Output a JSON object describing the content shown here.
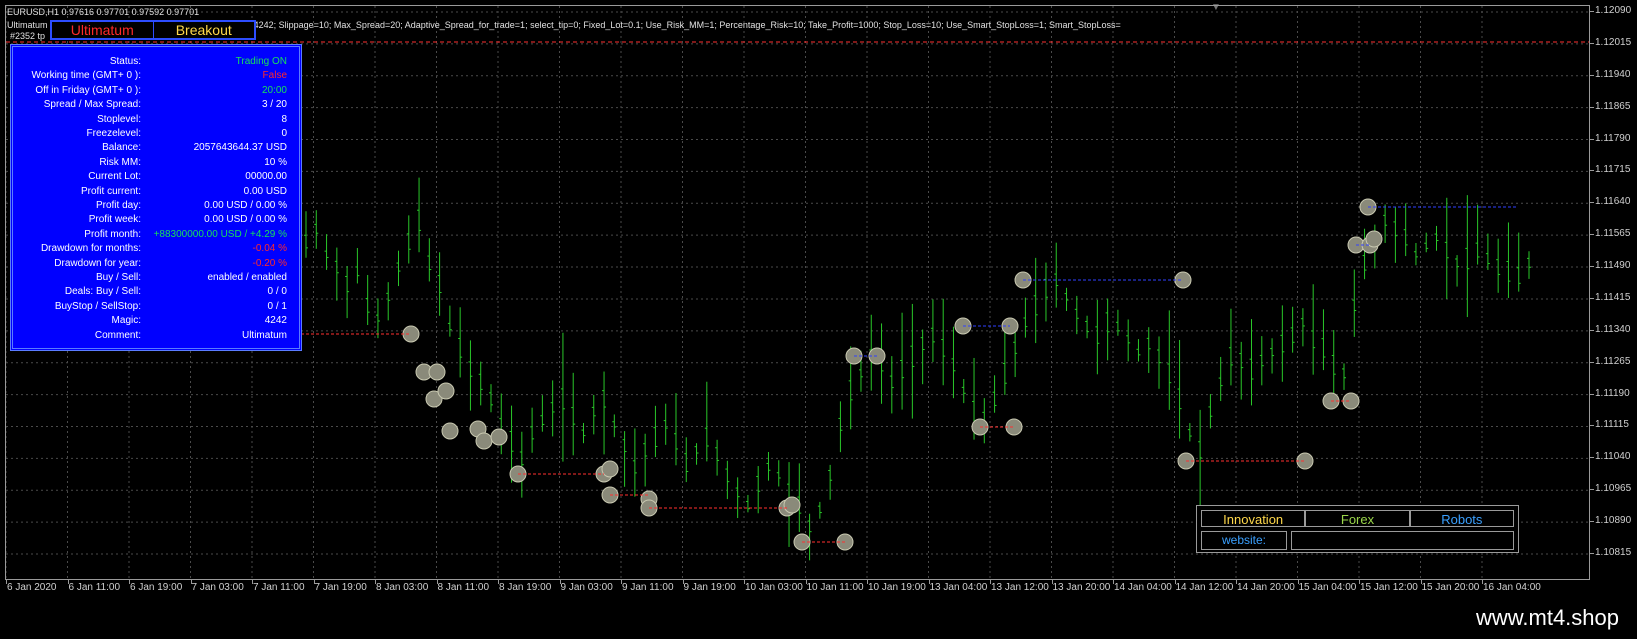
{
  "header": {
    "symbol_line": "EURUSD,H1  0.97616 0.97701 0.97592 0.97701",
    "ea_line": "Ultimatum Breakout_fix testing with Fast_BackTest=1; Magic=4242; Slippage=10; Max_Spread=20; Adaptive_Spread_for_trade=1; select_tip=0; Fixed_Lot=0.1; Use_Risk_MM=1; Percentage_Risk=10; Take_Profit=1000; Stop_Loss=10; Use_Smart_StopLoss=1; Smart_StopLoss=",
    "tp_label": "#2352 tp"
  },
  "brand_tabs": [
    {
      "label": "Ultimatum",
      "color": "#ff2a2a"
    },
    {
      "label": "Breakout",
      "color": "#ffd84a"
    }
  ],
  "status_panel": {
    "rows": [
      {
        "label": "Status:",
        "value": "Trading ON",
        "color": "#18e05a"
      },
      {
        "label": "Working time (GMT+ 0 ):",
        "value": "False",
        "color": "#ff2a2a"
      },
      {
        "label": "Off in Friday (GMT+ 0 ):",
        "value": "20:00",
        "color": "#18e05a"
      },
      {
        "label": "Spread / Max Spread:",
        "value": "3 / 20",
        "color": "#ffffff"
      },
      {
        "label": "Stoplevel:",
        "value": "8",
        "color": "#ffffff"
      },
      {
        "label": "Freezelevel:",
        "value": "0",
        "color": "#ffffff"
      },
      {
        "label": "Balance:",
        "value": "2057643644.37 USD",
        "color": "#ffffff"
      },
      {
        "label": "Risk MM:",
        "value": "10 %",
        "color": "#ffffff"
      },
      {
        "label": "Current Lot:",
        "value": "00000.00",
        "color": "#ffffff"
      },
      {
        "label": "Profit current:",
        "value": "0.00 USD",
        "color": "#ffffff"
      },
      {
        "label": "Profit day:",
        "value": "0.00 USD / 0.00 %",
        "color": "#ffffff"
      },
      {
        "label": "Profit week:",
        "value": "0.00 USD / 0.00 %",
        "color": "#ffffff"
      },
      {
        "label": "Profit month:",
        "value": "+88300000.00 USD / +4.29 %",
        "color": "#18e05a"
      },
      {
        "label": "Drawdown for months:",
        "value": "-0.04 %",
        "color": "#ff2a2a"
      },
      {
        "label": "Drawdown for year:",
        "value": "-0.20 %",
        "color": "#ff2a2a"
      },
      {
        "label": "Buy / Sell:",
        "value": "enabled  /  enabled",
        "color": "#ffffff"
      },
      {
        "label": "Deals: Buy / Sell:",
        "value": "0  /  0",
        "color": "#ffffff"
      },
      {
        "label": "BuyStop / SellStop:",
        "value": "0  /  1",
        "color": "#ffffff"
      },
      {
        "label": "Magic:",
        "value": "4242",
        "color": "#ffffff"
      },
      {
        "label": "Comment:",
        "value": "Ultimatum",
        "color": "#ffffff"
      }
    ]
  },
  "links_panel": {
    "items": [
      {
        "label": "Innovation",
        "color": "#ffd84a"
      },
      {
        "label": "Forex",
        "color": "#9ad64a"
      },
      {
        "label": "Robots",
        "color": "#3aa0ff"
      }
    ],
    "website_label": "website:"
  },
  "price_axis": {
    "labels": [
      "1.12090",
      "1.12015",
      "1.11940",
      "1.11865",
      "1.11790",
      "1.11715",
      "1.11640",
      "1.11565",
      "1.11490",
      "1.11415",
      "1.11340",
      "1.11265",
      "1.11190",
      "1.11115",
      "1.11040",
      "1.10965",
      "1.10890",
      "1.10815"
    ]
  },
  "time_axis": {
    "labels": [
      "6 Jan 2020",
      "6 Jan 11:00",
      "6 Jan 19:00",
      "7 Jan 03:00",
      "7 Jan 11:00",
      "7 Jan 19:00",
      "8 Jan 03:00",
      "8 Jan 11:00",
      "8 Jan 19:00",
      "9 Jan 03:00",
      "9 Jan 11:00",
      "9 Jan 19:00",
      "10 Jan 03:00",
      "10 Jan 11:00",
      "10 Jan 19:00",
      "13 Jan 04:00",
      "13 Jan 12:00",
      "13 Jan 20:00",
      "14 Jan 04:00",
      "14 Jan 12:00",
      "14 Jan 20:00",
      "15 Jan 04:00",
      "15 Jan 12:00",
      "15 Jan 20:00",
      "16 Jan 04:00"
    ]
  },
  "chart_data": {
    "type": "line",
    "title": "",
    "xlabel": "",
    "ylabel": "",
    "ylim": [
      1.10815,
      1.1209
    ],
    "grid": true,
    "colors": {
      "bars": "#29c729",
      "grid": "#4a4a4a",
      "background": "#000000",
      "stop_line": "#ff3030",
      "buy_line": "#3040ff"
    },
    "series": [
      {
        "values": [
          1.1155,
          1.1158,
          1.1152,
          1.1149,
          1.1145,
          1.1148,
          1.114,
          1.1137,
          1.1142,
          1.1149,
          1.1155,
          1.116,
          1.115,
          1.1145,
          1.1135,
          1.113,
          1.1125,
          1.1122,
          1.1118,
          1.1112,
          1.1108,
          1.1104,
          1.111,
          1.1113,
          1.1116,
          1.1118,
          1.1114,
          1.111,
          1.1115,
          1.1118,
          1.1112,
          1.1107,
          1.1102,
          1.1106,
          1.1109,
          1.1112,
          1.1108,
          1.1103,
          1.1106,
          1.1109,
          1.1105,
          1.11,
          1.1096,
          1.1093,
          1.1098,
          1.1102,
          1.11,
          1.1096,
          1.1093,
          1.1088,
          1.1092,
          1.11,
          1.1112,
          1.112,
          1.1124,
          1.1128,
          1.1126,
          1.1122,
          1.1125,
          1.1128,
          1.1131,
          1.1133,
          1.113,
          1.1126,
          1.112,
          1.1115,
          1.1113,
          1.1118,
          1.1124,
          1.113,
          1.1136,
          1.114,
          1.1144,
          1.1146,
          1.1142,
          1.1138,
          1.1135,
          1.1133,
          1.1136,
          1.1135,
          1.1132,
          1.1129,
          1.1131,
          1.1128,
          1.1124,
          1.1118,
          1.111,
          1.1106,
          1.1115,
          1.1122,
          1.1128,
          1.1127,
          1.1125,
          1.1127,
          1.1129,
          1.1131,
          1.1133,
          1.1136,
          1.1132,
          1.113,
          1.1126,
          1.1124,
          1.114,
          1.115,
          1.1155,
          1.116,
          1.1158,
          1.1156,
          1.1152,
          1.1154,
          1.1156,
          1.1153,
          1.115,
          1.1151,
          1.1153,
          1.1151,
          1.1149,
          1.1148,
          1.1147,
          1.115
        ]
      }
    ]
  }
}
